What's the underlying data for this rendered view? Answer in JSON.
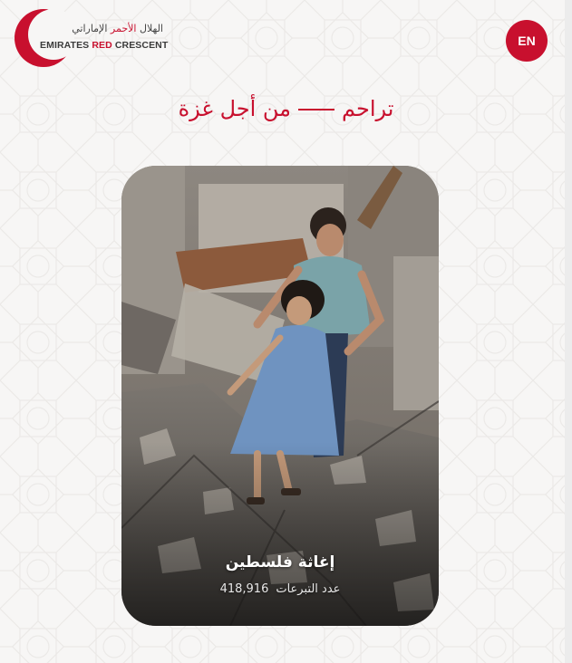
{
  "brand": {
    "name_ar_part1": "الهلال",
    "name_ar_part2": "الأحمر",
    "name_ar_part3": "الإماراتي",
    "name_en_part1": "EMIRATES",
    "name_en_part2": "RED",
    "name_en_part3": "CRESCENT",
    "color": "#c8102e"
  },
  "header": {
    "language_button": "EN"
  },
  "headline": {
    "left_text": "تراحم",
    "right_text": "من أجل غزة"
  },
  "campaign_card": {
    "title": "إغاثة فلسطين",
    "donations_label": "عدد التبرعات",
    "donations_count": "418,916",
    "image_subject": "children-in-rubble-photo"
  }
}
